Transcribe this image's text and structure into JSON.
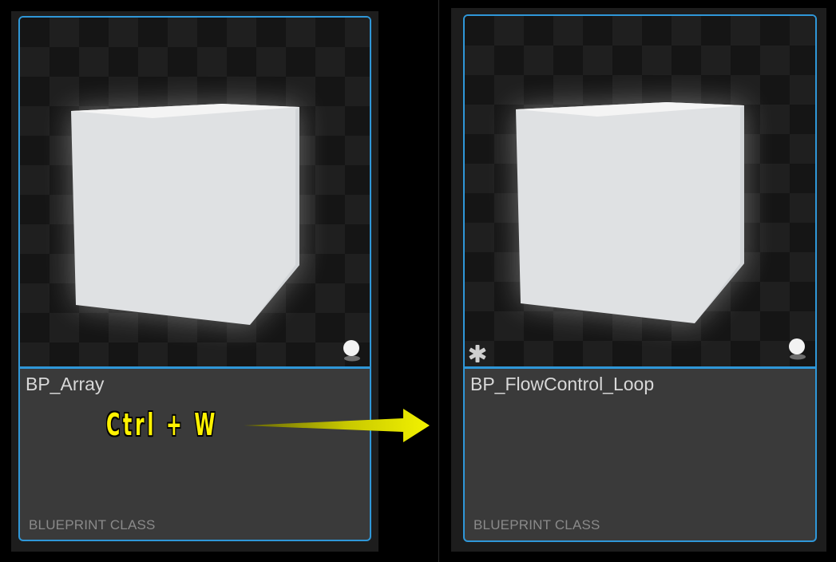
{
  "tiles": [
    {
      "name": "BP_Array",
      "type": "BLUEPRINT CLASS",
      "modified": false
    },
    {
      "name": "BP_FlowControl_Loop",
      "type": "BLUEPRINT CLASS",
      "modified": true
    }
  ],
  "annotation": {
    "shortcut": "Ctrl + W",
    "color": "#fff200"
  },
  "colors": {
    "selection_border": "#2f97d8",
    "tile_background": "#3a3a3a",
    "name_text": "#d8d8d8",
    "type_text": "#8a8a8a"
  },
  "icons": {
    "actor": "actor-icon",
    "unsaved": "asterisk-icon",
    "arrow": "arrow-right-icon"
  }
}
